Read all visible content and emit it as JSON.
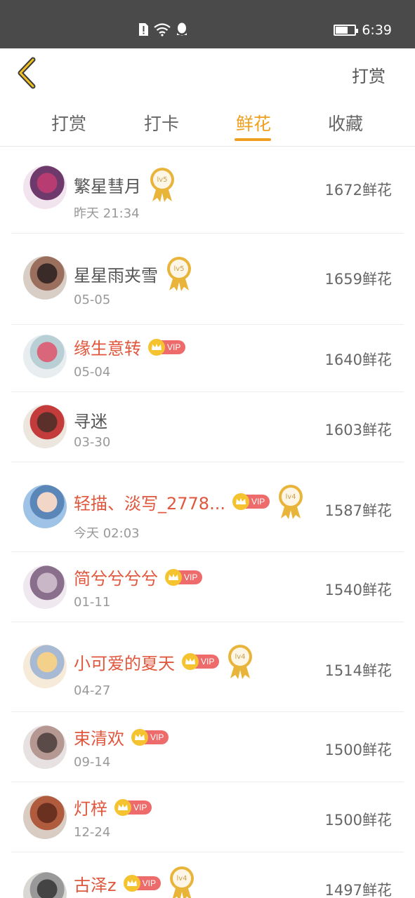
{
  "status_bar": {
    "time": "6:39",
    "icons": [
      "sim-alert-icon",
      "wifi-icon",
      "qq-icon"
    ],
    "battery_level": 0.6
  },
  "nav": {
    "back_icon": "chevron-left-icon",
    "action_label": "打赏"
  },
  "tabs": [
    {
      "label": "打赏",
      "active": false
    },
    {
      "label": "打卡",
      "active": false
    },
    {
      "label": "鲜花",
      "active": true
    },
    {
      "label": "收藏",
      "active": false
    }
  ],
  "colors": {
    "accent": "#f0a020",
    "vip_name": "#e0573e",
    "vip_badge": "#ee6b6b",
    "crown": "#f5c330",
    "medal": "#e9b43a"
  },
  "vip_label": "VIP",
  "list": [
    {
      "name": "繁星彗月",
      "vip": false,
      "level": "lv5",
      "date": "昨天 21:34",
      "amount": "1672鲜花"
    },
    {
      "name": "星星雨夹雪",
      "vip": false,
      "level": "lv5",
      "date": "05-05",
      "amount": "1659鲜花"
    },
    {
      "name": "缘生意转",
      "vip": true,
      "level": null,
      "date": "05-04",
      "amount": "1640鲜花"
    },
    {
      "name": "寻迷",
      "vip": false,
      "level": null,
      "date": "03-30",
      "amount": "1603鲜花"
    },
    {
      "name": "轻描、淡写_2778...",
      "vip": true,
      "level": "lv4",
      "date": "今天 02:03",
      "amount": "1587鲜花"
    },
    {
      "name": "简兮兮兮兮",
      "vip": true,
      "level": null,
      "date": "01-11",
      "amount": "1540鲜花"
    },
    {
      "name": "小可爱的夏天",
      "vip": true,
      "level": "lv4",
      "date": "04-27",
      "amount": "1514鲜花"
    },
    {
      "name": "束清欢",
      "vip": true,
      "level": null,
      "date": "09-14",
      "amount": "1500鲜花"
    },
    {
      "name": "灯梓",
      "vip": true,
      "level": null,
      "date": "12-24",
      "amount": "1500鲜花"
    },
    {
      "name": "古泽z",
      "vip": true,
      "level": "lv4",
      "date": "",
      "amount": "1497鲜花"
    }
  ]
}
